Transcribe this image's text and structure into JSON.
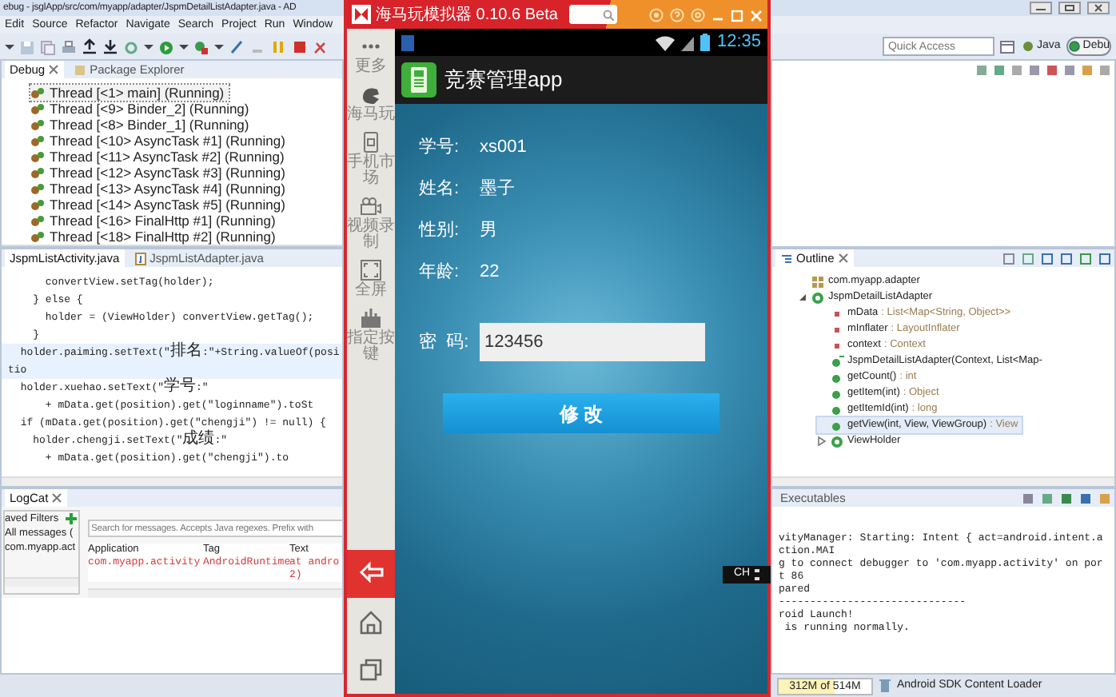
{
  "ide": {
    "title": "ebug - jsglApp/src/com/myapp/adapter/JspmDetailListAdapter.java - AD",
    "menu": [
      "Edit",
      "Source",
      "Refactor",
      "Navigate",
      "Search",
      "Project",
      "Run",
      "Window"
    ],
    "quick_access": {
      "placeholder": "Quick Access"
    },
    "perspectives": [
      {
        "label": "Java",
        "selected": false
      },
      {
        "label": "Debu",
        "selected": true
      }
    ]
  },
  "debug_view": {
    "tabs": [
      {
        "label": "Debug",
        "selected": true
      },
      {
        "label": "Package Explorer",
        "selected": false
      }
    ],
    "threads": [
      {
        "label": "Thread [<1> main] (Running)",
        "selected": true
      },
      {
        "label": "Thread [<9> Binder_2] (Running)",
        "selected": false
      },
      {
        "label": "Thread [<8> Binder_1] (Running)",
        "selected": false
      },
      {
        "label": "Thread [<10> AsyncTask #1] (Running)",
        "selected": false
      },
      {
        "label": "Thread [<11> AsyncTask #2] (Running)",
        "selected": false
      },
      {
        "label": "Thread [<12> AsyncTask #3] (Running)",
        "selected": false
      },
      {
        "label": "Thread [<13> AsyncTask #4] (Running)",
        "selected": false
      },
      {
        "label": "Thread [<14> AsyncTask #5] (Running)",
        "selected": false
      },
      {
        "label": "Thread [<16> FinalHttp #1] (Running)",
        "selected": false
      },
      {
        "label": "Thread [<18> FinalHttp #2] (Running)",
        "selected": false
      }
    ]
  },
  "editor": {
    "tabs": [
      {
        "label": "JspmListActivity.java",
        "selected": true
      },
      {
        "label": "JspmListAdapter.java",
        "selected": false
      }
    ],
    "lines": [
      {
        "text": "      convertView.setTag(holder);",
        "current": false
      },
      {
        "text": "    } else {",
        "current": false
      },
      {
        "text": "      holder = (ViewHolder) convertView.getTag();",
        "current": false
      },
      {
        "text": "    }",
        "current": false
      },
      {
        "text": "  holder.paiming.setText(\"排名:\"+String.valueOf(positio",
        "current": true
      },
      {
        "text": "  holder.xuehao.setText(\"学号:\"",
        "current": false
      },
      {
        "text": "      + mData.get(position).get(\"loginname\").toSt",
        "current": false
      },
      {
        "text": "  if (mData.get(position).get(\"chengji\") != null) {",
        "current": false
      },
      {
        "text": "    holder.chengji.setText(\"成绩:\"",
        "current": false
      },
      {
        "text": "      + mData.get(position).get(\"chengji\").to",
        "current": false
      }
    ]
  },
  "outline": {
    "title": "Outline",
    "items": [
      {
        "kind": "package",
        "name": "com.myapp.adapter",
        "selected": false
      },
      {
        "kind": "class",
        "name": "JspmDetailListAdapter",
        "selected": false,
        "expanded": true,
        "children": [
          {
            "kind": "field",
            "name": "mData",
            "type": ": List<Map<String, Object>>",
            "selected": false
          },
          {
            "kind": "field",
            "name": "mInflater",
            "type": ": LayoutInflater",
            "selected": false
          },
          {
            "kind": "field",
            "name": "context",
            "type": ": Context",
            "selected": false
          },
          {
            "kind": "constructor",
            "name": "JspmDetailListAdapter(Context, List<Map-",
            "selected": false
          },
          {
            "kind": "method",
            "name": "getCount()",
            "type": ": int",
            "selected": false
          },
          {
            "kind": "method",
            "name": "getItem(int)",
            "type": ": Object",
            "selected": false
          },
          {
            "kind": "method",
            "name": "getItemId(int)",
            "type": ": long",
            "selected": false
          },
          {
            "kind": "method",
            "name": "getView(int, View, ViewGroup)",
            "type": ": View",
            "selected": true
          },
          {
            "kind": "class",
            "name": "ViewHolder",
            "selected": false,
            "expanded": false
          }
        ]
      }
    ]
  },
  "logcat": {
    "title": "LogCat",
    "filters_title": "aved Filters",
    "filters": [
      {
        "label": "All messages (",
        "selected": false
      },
      {
        "label": "com.myapp.act",
        "selected": false
      }
    ],
    "search": {
      "placeholder": "Search for messages. Accepts Java regexes. Prefix with"
    },
    "columns": [
      "Application",
      "Tag",
      "Text"
    ],
    "rows": [
      [
        "com.myapp.activity",
        "AndroidRuntime",
        "at andro\n2)"
      ]
    ]
  },
  "console": {
    "tab": "Executables",
    "lines": [
      "vityManager: Starting: Intent { act=android.intent.action.MAI",
      "g to connect debugger to 'com.myapp.activity' on port 86",
      "pared",
      "------------------------------",
      "roid Launch!",
      " is running normally."
    ]
  },
  "status_bar": {
    "memory": {
      "text": "312M of 514M",
      "level": 0.6
    },
    "task": "Android SDK Content Loader"
  },
  "ime_indicator": "CH",
  "emulator": {
    "title": "海马玩模拟器 0.10.6 Beta",
    "sidebar": [
      {
        "kind": "more",
        "label": "更多"
      },
      {
        "kind": "hippo",
        "label": "海马玩"
      },
      {
        "kind": "market",
        "label": "手机市场"
      },
      {
        "kind": "record",
        "label": "视频录制"
      },
      {
        "kind": "fullscreen",
        "label": "全屏"
      },
      {
        "kind": "keys",
        "label": "指定按键"
      }
    ],
    "nav": [
      {
        "kind": "back",
        "selected": true
      },
      {
        "kind": "home",
        "selected": false
      },
      {
        "kind": "recents",
        "selected": false
      }
    ],
    "phone": {
      "time": "12:35",
      "app_title": "竞赛管理app",
      "fields": [
        {
          "label": "学号:",
          "value": "xs001"
        },
        {
          "label": "姓名:",
          "value": "墨子"
        },
        {
          "label": "性别:",
          "value": "男"
        },
        {
          "label": "年龄:",
          "value": "22"
        }
      ],
      "password": {
        "label": "密  码:",
        "value": "123456"
      },
      "button": "修 改"
    }
  }
}
